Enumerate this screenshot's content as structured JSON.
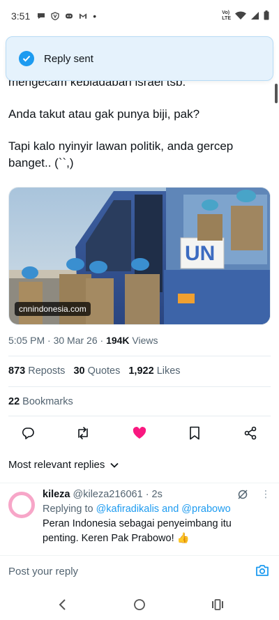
{
  "status_bar": {
    "time": "3:51",
    "dot": "•",
    "lte_top": "Vo)",
    "lte_bottom": "LTE",
    "icons": [
      "chat-bubble-icon",
      "shield-v-icon",
      "discord-icon",
      "gmail-icon",
      "wifi-icon",
      "signal-icon",
      "battery-icon"
    ]
  },
  "toast": {
    "text": "Reply sent"
  },
  "tweet": {
    "line_partial": "mengecam kebiadaban israel tsb.",
    "line_2": "Anda takut atau gak punya biji, pak?",
    "line_3": "Tapi kalo nyinyir lawan politik, anda gercep banget.. (``,)"
  },
  "media": {
    "caption": "cnnindonesia.com",
    "sign_text": "UN"
  },
  "meta": {
    "time": "5:05 PM · 30 Mar 26 · ",
    "views": "194K",
    "views_label": " Views"
  },
  "stats": {
    "reposts": "873",
    "reposts_label": "Reposts",
    "quotes": "30",
    "quotes_label": "Quotes",
    "likes": "1,922",
    "likes_label": "Likes"
  },
  "bookmarks": {
    "count": "22",
    "label": "Bookmarks"
  },
  "replies_header": {
    "label": "Most relevant replies"
  },
  "reply": {
    "name": "kileza",
    "handle": "@kileza216061 · 2s",
    "replying_prefix": "Replying to ",
    "replying_mentions": "@kafiradikalis and @prabowo",
    "text": "Peran Indonesia sebagai penyeimbang itu penting. Keren Pak Prabowo! 👍",
    "more": "⋮"
  },
  "post_reply": {
    "placeholder": "Post your reply"
  },
  "colors": {
    "accent": "#1d9bf0",
    "like": "#f91880",
    "text": "#0f1419",
    "muted": "#536471",
    "avatar_ring": "#f7a6c8"
  }
}
